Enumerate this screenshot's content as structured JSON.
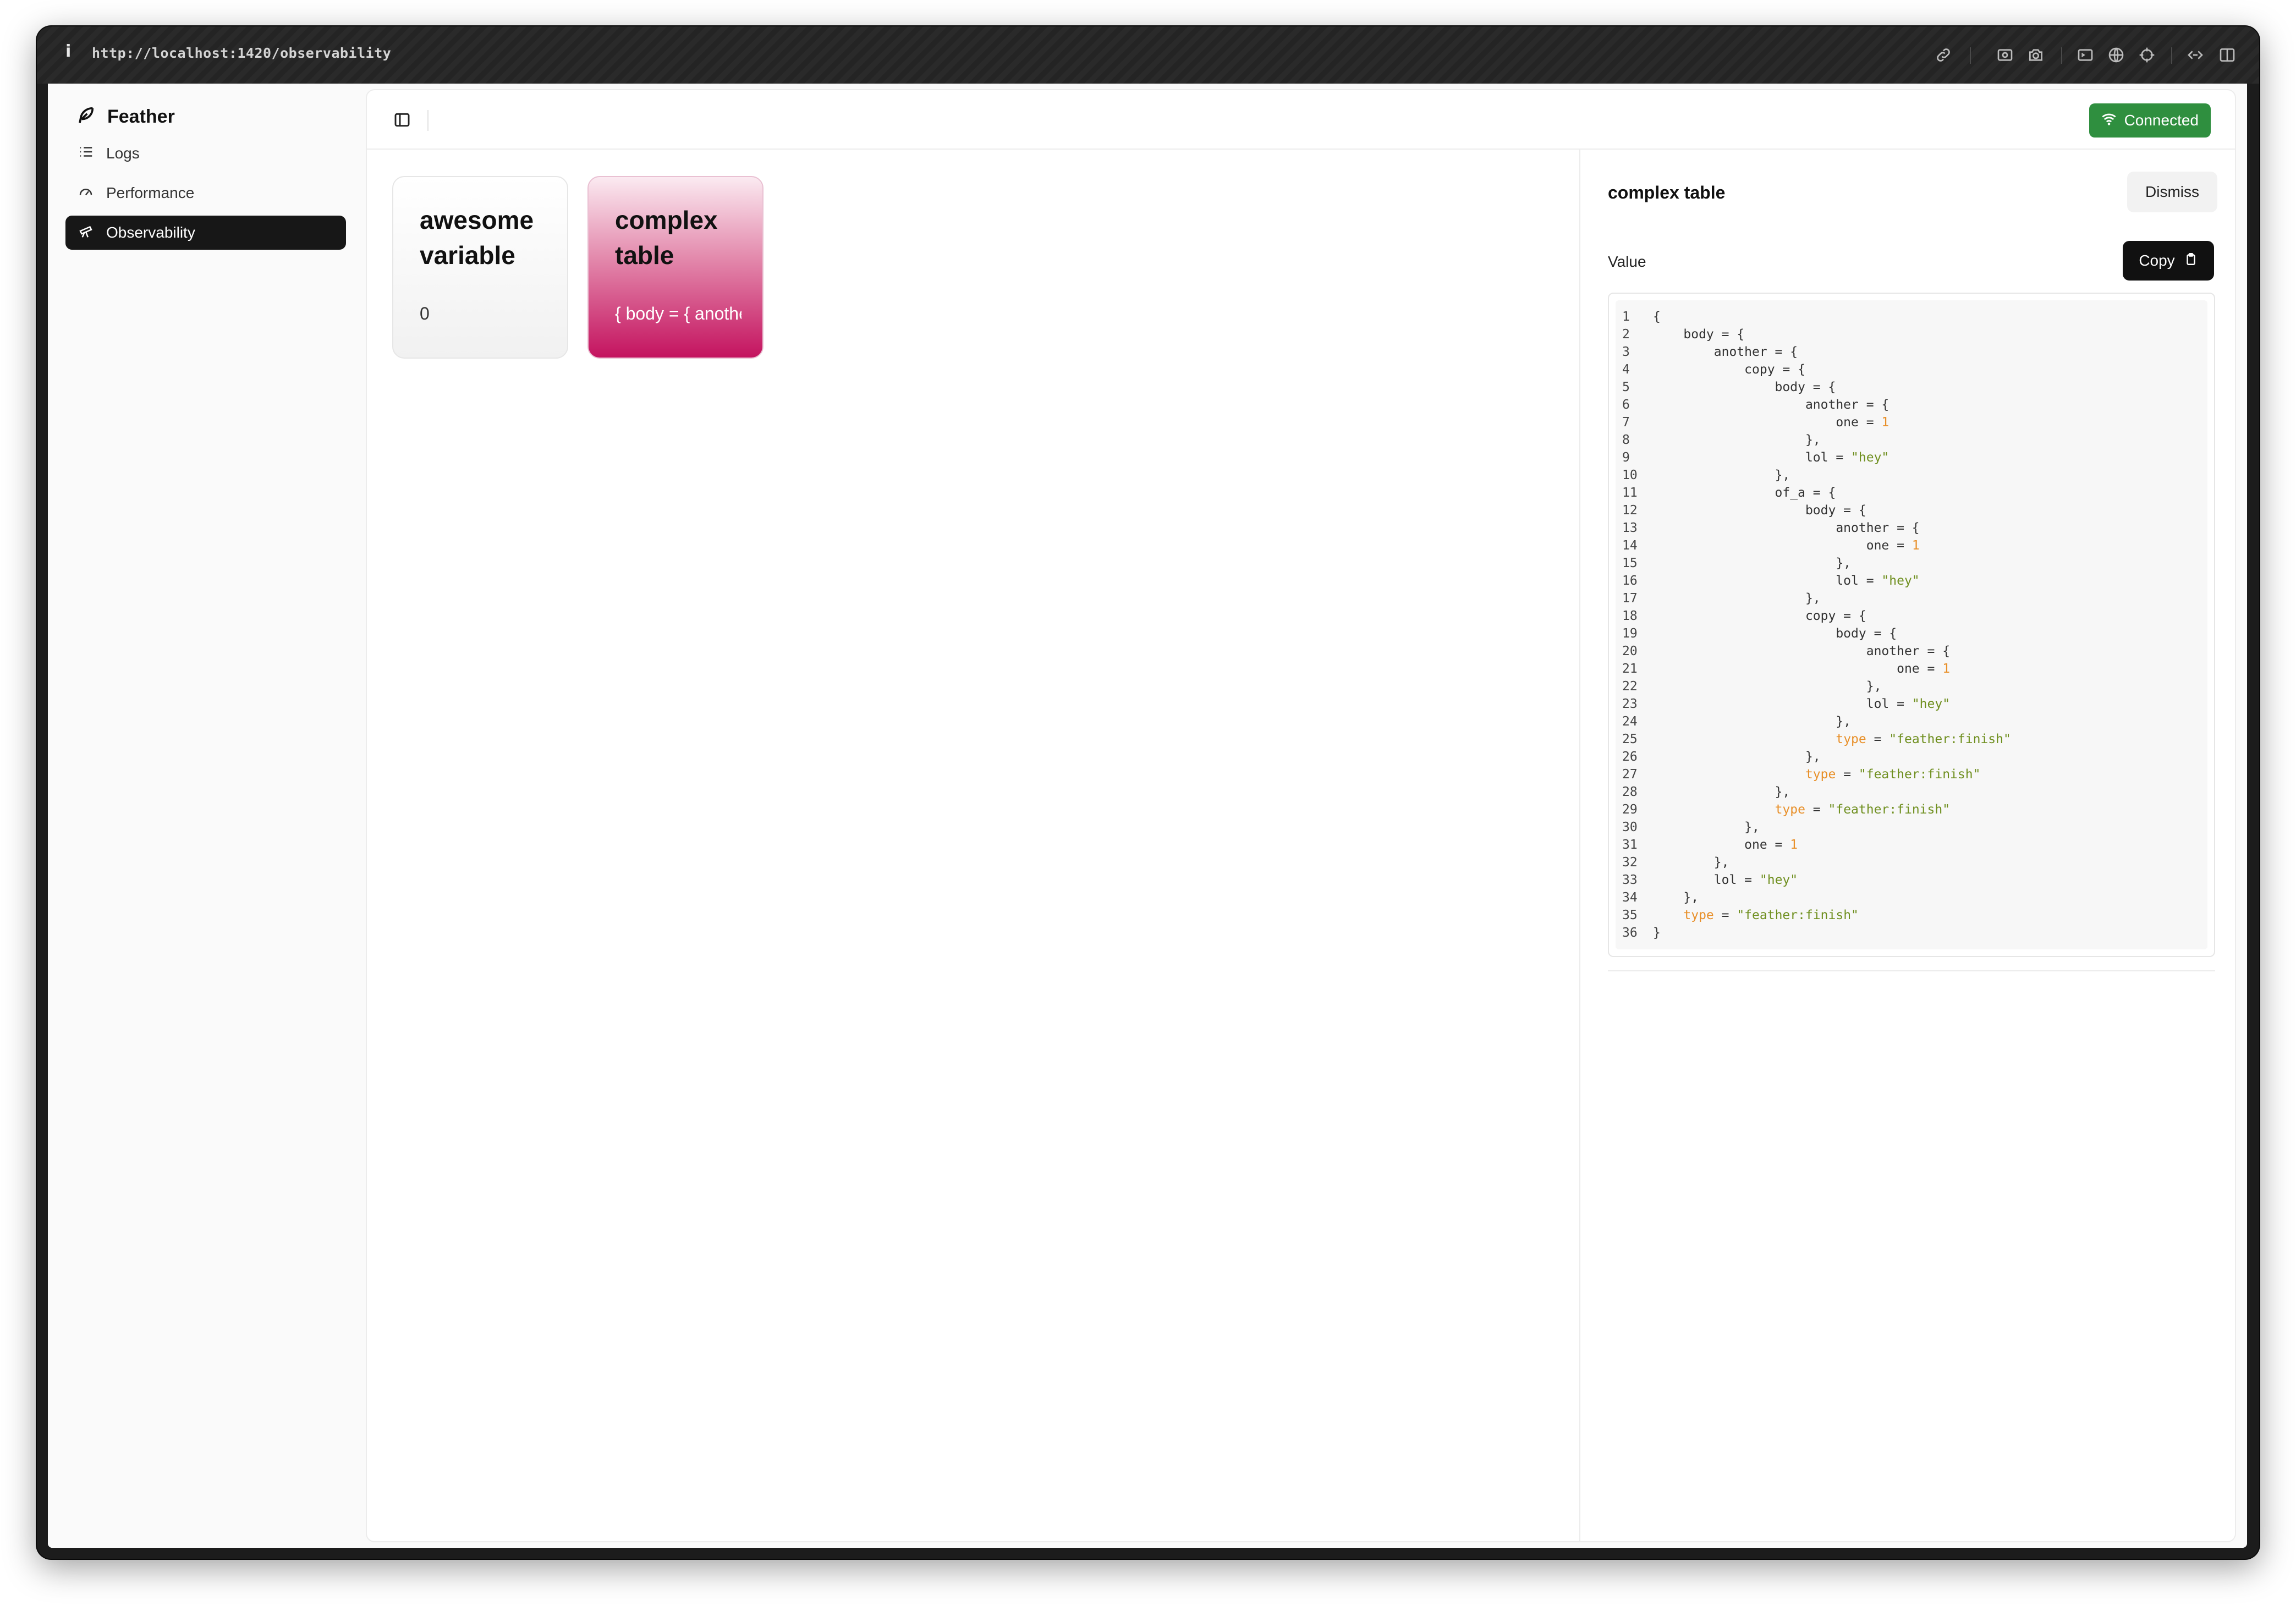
{
  "browser": {
    "url": "http://localhost:1420/observability",
    "info_glyph": "i",
    "toolbar_icons": [
      "link-icon",
      "screen-record-icon",
      "camera-icon",
      "terminal-icon",
      "globe-icon",
      "crosshair-icon",
      "devtools-icon",
      "split-view-icon"
    ]
  },
  "sidebar": {
    "brand": "Feather",
    "items": [
      {
        "label": "Logs",
        "icon": "list-icon",
        "active": false
      },
      {
        "label": "Performance",
        "icon": "gauge-icon",
        "active": false
      },
      {
        "label": "Observability",
        "icon": "telescope-icon",
        "active": true
      }
    ]
  },
  "topbar": {
    "status": "Connected",
    "status_color": "#2f8f3f"
  },
  "cards": [
    {
      "title": "awesome variable",
      "value": "0"
    },
    {
      "title": "complex table",
      "value": "{ body = { another = {"
    }
  ],
  "accent": {
    "card_pink": "#c4135f",
    "dark": "#171717"
  },
  "detail": {
    "title": "complex table",
    "dismiss_label": "Dismiss",
    "value_label": "Value",
    "copy_label": "Copy",
    "code_lines": [
      [
        {
          "t": "{"
        }
      ],
      [
        {
          "t": "    body = {"
        }
      ],
      [
        {
          "t": "        another = {"
        }
      ],
      [
        {
          "t": "            copy = {"
        }
      ],
      [
        {
          "t": "                body = {"
        }
      ],
      [
        {
          "t": "                    another = {"
        }
      ],
      [
        {
          "t": "                        one = "
        },
        {
          "t": "1",
          "c": "num"
        }
      ],
      [
        {
          "t": "                    },"
        }
      ],
      [
        {
          "t": "                    lol = "
        },
        {
          "t": "\"hey\"",
          "c": "str"
        }
      ],
      [
        {
          "t": "                },"
        }
      ],
      [
        {
          "t": "                of_a = {"
        }
      ],
      [
        {
          "t": "                    body = {"
        }
      ],
      [
        {
          "t": "                        another = {"
        }
      ],
      [
        {
          "t": "                            one = "
        },
        {
          "t": "1",
          "c": "num"
        }
      ],
      [
        {
          "t": "                        },"
        }
      ],
      [
        {
          "t": "                        lol = "
        },
        {
          "t": "\"hey\"",
          "c": "str"
        }
      ],
      [
        {
          "t": "                    },"
        }
      ],
      [
        {
          "t": "                    copy = {"
        }
      ],
      [
        {
          "t": "                        body = {"
        }
      ],
      [
        {
          "t": "                            another = {"
        }
      ],
      [
        {
          "t": "                                one = "
        },
        {
          "t": "1",
          "c": "num"
        }
      ],
      [
        {
          "t": "                            },"
        }
      ],
      [
        {
          "t": "                            lol = "
        },
        {
          "t": "\"hey\"",
          "c": "str"
        }
      ],
      [
        {
          "t": "                        },"
        }
      ],
      [
        {
          "t": "                        "
        },
        {
          "t": "type",
          "c": "key"
        },
        {
          "t": " = "
        },
        {
          "t": "\"feather:finish\"",
          "c": "str"
        }
      ],
      [
        {
          "t": "                    },"
        }
      ],
      [
        {
          "t": "                    "
        },
        {
          "t": "type",
          "c": "key"
        },
        {
          "t": " = "
        },
        {
          "t": "\"feather:finish\"",
          "c": "str"
        }
      ],
      [
        {
          "t": "                },"
        }
      ],
      [
        {
          "t": "                "
        },
        {
          "t": "type",
          "c": "key"
        },
        {
          "t": " = "
        },
        {
          "t": "\"feather:finish\"",
          "c": "str"
        }
      ],
      [
        {
          "t": "            },"
        }
      ],
      [
        {
          "t": "            one = "
        },
        {
          "t": "1",
          "c": "num"
        }
      ],
      [
        {
          "t": "        },"
        }
      ],
      [
        {
          "t": "        lol = "
        },
        {
          "t": "\"hey\"",
          "c": "str"
        }
      ],
      [
        {
          "t": "    },"
        }
      ],
      [
        {
          "t": "    "
        },
        {
          "t": "type",
          "c": "key"
        },
        {
          "t": " = "
        },
        {
          "t": "\"feather:finish\"",
          "c": "str"
        }
      ],
      [
        {
          "t": "}"
        }
      ]
    ]
  }
}
